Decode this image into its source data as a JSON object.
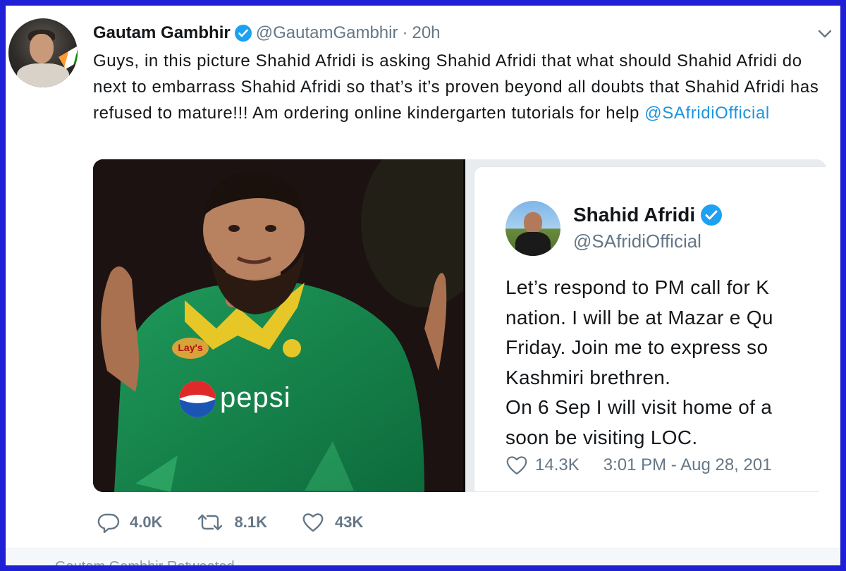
{
  "tweet": {
    "author_name": "Gautam Gambhir",
    "handle": "@GautamGambhir",
    "separator": "·",
    "time": "20h",
    "text_before": "Guys, in this picture Shahid Afridi is asking Shahid Afridi that what should Shahid Afridi do next to embarrass Shahid Afridi so that’s it’s proven beyond all doubts that Shahid Afridi has refused to mature!!! Am ordering online kindergarten tutorials for help ",
    "mention": "@SAfridiOfficial"
  },
  "photo": {
    "jersey_brand": "pepsi",
    "sponsor_badge": "Lay's"
  },
  "embedded": {
    "name": "Shahid Afridi",
    "handle": "@SAfridiOfficial",
    "lines": [
      "Let’s respond to PM call for K",
      "nation. I will be at Mazar e Qu",
      "Friday. Join me to express so",
      "Kashmiri brethren.",
      "On 6 Sep I will visit home of a",
      "soon be visiting LOC."
    ],
    "likes": "14.3K",
    "timestamp": "3:01 PM - Aug 28, 201"
  },
  "actions": {
    "replies": "4.0K",
    "retweets": "8.1K",
    "likes": "43K"
  },
  "bottom": {
    "partial_text": "Gautam Gambhir Retweeted"
  },
  "colors": {
    "frame": "#1f1fd6",
    "link": "#1b95e0",
    "verified": "#1da1f2",
    "muted": "#657786"
  },
  "icons": [
    "verified-badge-icon",
    "chevron-down-icon",
    "reply-icon",
    "retweet-icon",
    "heart-icon"
  ]
}
